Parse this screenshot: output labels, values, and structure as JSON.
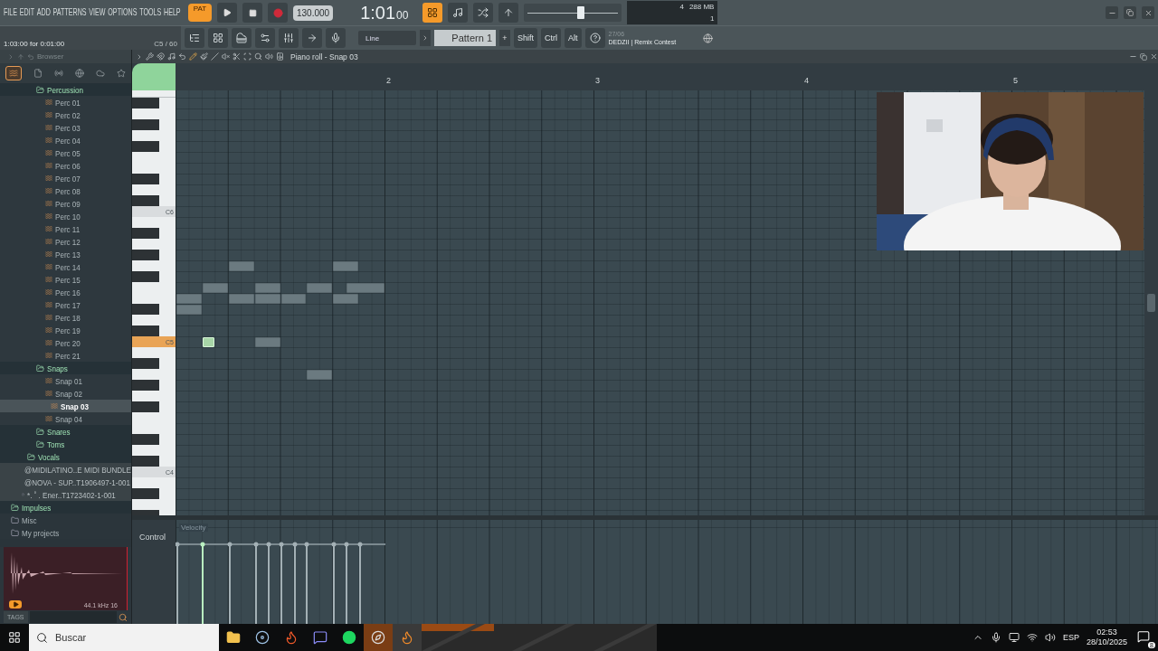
{
  "menu": [
    "FILE",
    "EDIT",
    "ADD",
    "PATTERNS",
    "VIEW",
    "OPTIONS",
    "TOOLS",
    "HELP"
  ],
  "transport": {
    "mode": "PAT",
    "tempo": "130.000",
    "time": "1:01",
    "time_sub": "00",
    "recording": false
  },
  "master_volume": {
    "level": 0.58
  },
  "meters": {
    "polyphony": "4",
    "memory": "288 MB",
    "cpu": "1"
  },
  "hint": {
    "position": "1:03:00 for 0:01:00",
    "note": "C5 / 60"
  },
  "snap": {
    "value": "Line"
  },
  "pattern": {
    "label": "Pattern 1",
    "add": "+"
  },
  "modifiers": [
    "Shift",
    "Ctrl",
    "Alt"
  ],
  "news": {
    "date": "27/06",
    "title": "DEDZII | Remix Contest"
  },
  "browser": {
    "title": "Browser",
    "tree": [
      {
        "label": "Percussion",
        "kind": "subfolder",
        "selected": false,
        "children": [
          {
            "label": "Perc 01",
            "kind": "file",
            "selected": false
          },
          {
            "label": "Perc 02",
            "kind": "file",
            "selected": false
          },
          {
            "label": "Perc 03",
            "kind": "file",
            "selected": false
          },
          {
            "label": "Perc 04",
            "kind": "file",
            "selected": false
          },
          {
            "label": "Perc 05",
            "kind": "file",
            "selected": false
          },
          {
            "label": "Perc 06",
            "kind": "file",
            "selected": false
          },
          {
            "label": "Perc 07",
            "kind": "file",
            "selected": false
          },
          {
            "label": "Perc 08",
            "kind": "file",
            "selected": false
          },
          {
            "label": "Perc 09",
            "kind": "file",
            "selected": false
          },
          {
            "label": "Perc 10",
            "kind": "file",
            "selected": false
          },
          {
            "label": "Perc 11",
            "kind": "file",
            "selected": false
          },
          {
            "label": "Perc 12",
            "kind": "file",
            "selected": false
          },
          {
            "label": "Perc 13",
            "kind": "file",
            "selected": false
          },
          {
            "label": "Perc 14",
            "kind": "file",
            "selected": false
          },
          {
            "label": "Perc 15",
            "kind": "file",
            "selected": false
          },
          {
            "label": "Perc 16",
            "kind": "file",
            "selected": false
          },
          {
            "label": "Perc 17",
            "kind": "file",
            "selected": false
          },
          {
            "label": "Perc 18",
            "kind": "file",
            "selected": false
          },
          {
            "label": "Perc 19",
            "kind": "file",
            "selected": false
          },
          {
            "label": "Perc 20",
            "kind": "file",
            "selected": false
          },
          {
            "label": "Perc 21",
            "kind": "file",
            "selected": false
          }
        ]
      },
      {
        "label": "Snaps",
        "kind": "subfolder",
        "selected": false,
        "children": [
          {
            "label": "Snap 01",
            "kind": "file",
            "selected": false
          },
          {
            "label": "Snap 02",
            "kind": "file",
            "selected": false
          },
          {
            "label": "Snap 03",
            "kind": "file",
            "selected": true
          },
          {
            "label": "Snap 04",
            "kind": "file",
            "selected": false
          }
        ]
      },
      {
        "label": "Snares",
        "kind": "subfolder",
        "selected": false
      },
      {
        "label": "Toms",
        "kind": "subfolder",
        "selected": false
      },
      {
        "label": "Vocals",
        "kind": "folder",
        "selected": false
      },
      {
        "label": "@MIDILATINO..E MIDI BUNDLE",
        "kind": "pack",
        "selected": false
      },
      {
        "label": "@NOVA - SUP..T1906497-1-001",
        "kind": "pack",
        "selected": false
      },
      {
        "label": "*. ˚ . Ener..T1723402-1-001",
        "kind": "pack",
        "selected": false
      },
      {
        "label": "Impulses",
        "kind": "top",
        "selected": false
      },
      {
        "label": "Misc",
        "kind": "plain",
        "selected": false
      },
      {
        "label": "My projects",
        "kind": "plain",
        "selected": false
      }
    ],
    "preview_info": "44.1 kHz 16",
    "tags": "TAGS"
  },
  "piano_roll": {
    "title": "Piano roll - Snap 03",
    "bars": [
      "2",
      "3",
      "4",
      "5"
    ],
    "keys": [
      {
        "label": "C6",
        "selected": false
      },
      {
        "label": "C5",
        "selected": true
      },
      {
        "label": "C4",
        "selected": false
      }
    ],
    "control": "Control",
    "control_target": "Velocity"
  },
  "taskbar": {
    "search": "Buscar",
    "language": "ESP",
    "time": "02:53",
    "date": "28/10/2025",
    "notifications": "8"
  }
}
